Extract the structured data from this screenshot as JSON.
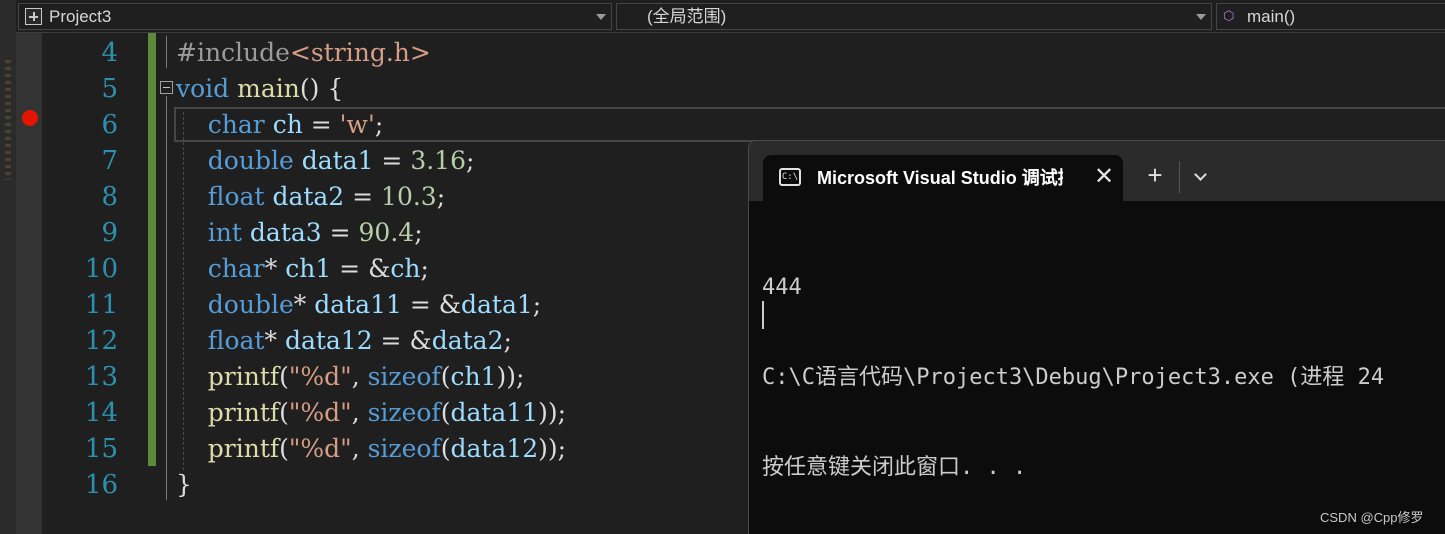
{
  "navbar": {
    "project": "Project3",
    "scope": "(全局范围)",
    "function": "main()",
    "project_icon": "project-icon",
    "function_icon": "cube-icon"
  },
  "editor": {
    "breakpoint_line": 6,
    "lines": [
      {
        "number": "4",
        "text": "#include<string.h>"
      },
      {
        "number": "5",
        "text": "void main() {"
      },
      {
        "number": "6",
        "text": "    char ch = 'w';"
      },
      {
        "number": "7",
        "text": "    double data1 = 3.16;"
      },
      {
        "number": "8",
        "text": "    float data2 = 10.3;"
      },
      {
        "number": "9",
        "text": "    int data3 = 90.4;"
      },
      {
        "number": "10",
        "text": "    char* ch1 = &ch;"
      },
      {
        "number": "11",
        "text": "    double* data11 = &data1;"
      },
      {
        "number": "12",
        "text": "    float* data12 = &data2;"
      },
      {
        "number": "13",
        "text": "    printf(\"%d\", sizeof(ch1));"
      },
      {
        "number": "14",
        "text": "    printf(\"%d\", sizeof(data11));"
      },
      {
        "number": "15",
        "text": "    printf(\"%d\", sizeof(data12));"
      },
      {
        "number": "16",
        "text": "}"
      }
    ]
  },
  "terminal": {
    "tab_title": "Microsoft Visual Studio 调试控制台",
    "tab_icon": "cmd-icon",
    "close_label": "✕",
    "new_tab_label": "+",
    "output": [
      "444",
      "C:\\C语言代码\\Project3\\Debug\\Project3.exe (进程 24",
      "按任意键关闭此窗口. . ."
    ]
  },
  "watermark": "CSDN @Cpp修罗",
  "colors": {
    "keyword": "#569cd6",
    "function": "#dcdcaa",
    "string": "#d69d85",
    "number": "#b5cea8",
    "line_number": "#2b91af",
    "breakpoint": "#e51400",
    "change_bar": "#5d8a3a"
  }
}
